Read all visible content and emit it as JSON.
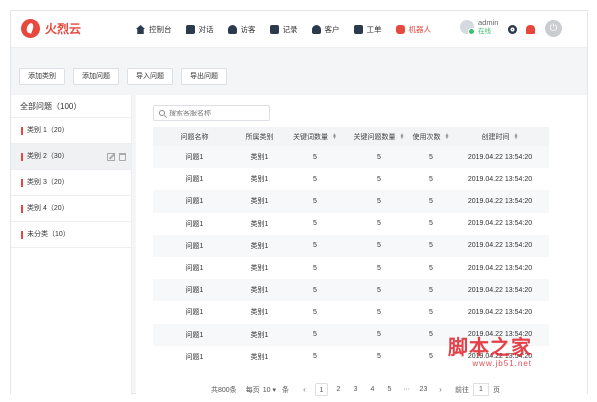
{
  "brand": {
    "name": "火烈云",
    "color": "#e8473d"
  },
  "nav": [
    {
      "label": "控制台",
      "icon": "home-icon"
    },
    {
      "label": "对话",
      "icon": "chat-icon"
    },
    {
      "label": "访客",
      "icon": "visitor-icon"
    },
    {
      "label": "记录",
      "icon": "record-icon"
    },
    {
      "label": "客户",
      "icon": "customer-icon"
    },
    {
      "label": "工单",
      "icon": "ticket-icon"
    },
    {
      "label": "机器人",
      "icon": "robot-icon",
      "active": true
    }
  ],
  "user": {
    "name": "admin",
    "status": "在线"
  },
  "toolbar": {
    "add_category": "添加类别",
    "add_question": "添加问题",
    "import_questions": "导入问题",
    "export_questions": "导出问题"
  },
  "sidebar": {
    "title": "全部问题（100）",
    "categories": [
      {
        "label": "类别 1（20）",
        "selected": false
      },
      {
        "label": "类别 2（30）",
        "selected": true
      },
      {
        "label": "类别 3（20）",
        "selected": false
      },
      {
        "label": "类别 4（20）",
        "selected": false
      },
      {
        "label": "未分类（10）",
        "selected": false
      }
    ]
  },
  "search": {
    "placeholder": "搜索客服名称"
  },
  "table": {
    "headers": [
      "问题名称",
      "所属类别",
      "关键词数量",
      "关键问题数量",
      "使用次数",
      "创建时间"
    ],
    "rows": [
      [
        "问题1",
        "类别1",
        "5",
        "5",
        "5",
        "2019.04.22 13:54:20"
      ],
      [
        "问题1",
        "类别1",
        "5",
        "5",
        "5",
        "2019.04.22 13:54:20"
      ],
      [
        "问题1",
        "类别1",
        "5",
        "5",
        "5",
        "2019.04.22 13:54:20"
      ],
      [
        "问题1",
        "类别1",
        "5",
        "5",
        "5",
        "2019.04.22 13:54:20"
      ],
      [
        "问题1",
        "类别1",
        "5",
        "5",
        "5",
        "2019.04.22 13:54:20"
      ],
      [
        "问题1",
        "类别1",
        "5",
        "5",
        "5",
        "2019.04.22 13:54:20"
      ],
      [
        "问题1",
        "类别1",
        "5",
        "5",
        "5",
        "2019.04.22 13:54:20"
      ],
      [
        "问题1",
        "类别1",
        "5",
        "5",
        "5",
        "2019.04.22 13:54:20"
      ],
      [
        "问题1",
        "类别1",
        "5",
        "5",
        "5",
        "2019.04.22 13:54:20"
      ],
      [
        "问题1",
        "类别1",
        "5",
        "5",
        "5",
        "2019.04.22 13:54:20"
      ]
    ]
  },
  "pagination": {
    "total": "共800条",
    "per_page_label": "每页",
    "per_page_value": "10",
    "per_page_unit": "条",
    "pages": [
      "1",
      "2",
      "3",
      "4",
      "5",
      "···",
      "23"
    ],
    "current": "1",
    "goto_label": "前往",
    "goto_value": "1",
    "goto_unit": "页"
  },
  "watermark": {
    "title": "脚本之家",
    "sub": "www.jb51.net"
  }
}
